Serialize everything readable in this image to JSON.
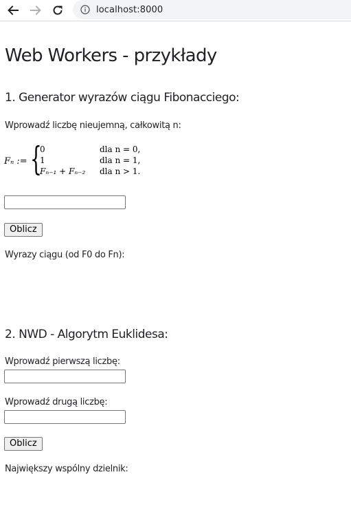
{
  "browser": {
    "url": "localhost:8000"
  },
  "page": {
    "title": "Web Workers - przykłady",
    "fibonacci": {
      "heading": "1. Generator wyrazów ciągu Fibonacciego:",
      "prompt": "Wprowadź liczbę nieujemną, całkowitą n:",
      "formula": {
        "lhs": "Fₙ :=",
        "cases": [
          {
            "expr": "0",
            "cond": "dla n = 0,"
          },
          {
            "expr": "1",
            "cond": "dla n = 1,"
          },
          {
            "expr": "Fₙ₋₁ + Fₙ₋₂",
            "cond": "dla n > 1."
          }
        ]
      },
      "input_value": "",
      "button_label": "Oblicz",
      "result_label": "Wyrazy ciągu (od F0 do Fn):"
    },
    "gcd": {
      "heading": "2. NWD - Algorytm Euklidesa:",
      "first_label": "Wprowadź pierwszą liczbę:",
      "first_value": "",
      "second_label": "Wprowadź drugą liczbę:",
      "second_value": "",
      "button_label": "Oblicz",
      "result_label": "Największy wspólny dzielnik:"
    }
  },
  "icons": {
    "back": "arrow-left-icon",
    "forward": "arrow-right-icon",
    "reload": "reload-icon",
    "info": "info-icon"
  },
  "colors": {
    "omnibox_bg": "#f1f3f4",
    "button_bg": "#efefef",
    "disabled_icon": "#b0b0b0"
  }
}
